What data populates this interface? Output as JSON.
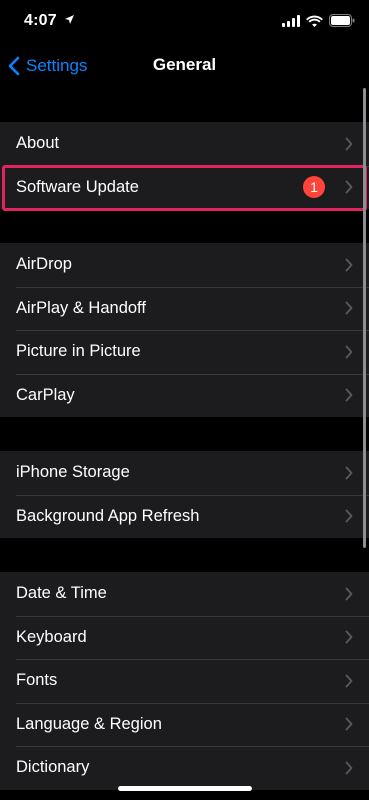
{
  "status_bar": {
    "time": "4:07",
    "icons": [
      "location-arrow-icon",
      "cellular-signal-icon",
      "wifi-icon",
      "battery-icon"
    ]
  },
  "nav": {
    "back_label": "Settings",
    "title": "General"
  },
  "groups": [
    {
      "rows": [
        {
          "label": "About"
        },
        {
          "label": "Software Update",
          "badge": "1",
          "highlighted": true
        }
      ]
    },
    {
      "rows": [
        {
          "label": "AirDrop"
        },
        {
          "label": "AirPlay & Handoff"
        },
        {
          "label": "Picture in Picture"
        },
        {
          "label": "CarPlay"
        }
      ]
    },
    {
      "rows": [
        {
          "label": "iPhone Storage"
        },
        {
          "label": "Background App Refresh"
        }
      ]
    },
    {
      "rows": [
        {
          "label": "Date & Time"
        },
        {
          "label": "Keyboard"
        },
        {
          "label": "Fonts"
        },
        {
          "label": "Language & Region"
        },
        {
          "label": "Dictionary"
        }
      ]
    }
  ],
  "colors": {
    "accent": "#0a84ff",
    "badge": "#ff453a",
    "highlight_border": "#e0245e",
    "group_background": "#1c1c1e",
    "page_background": "#000000"
  }
}
